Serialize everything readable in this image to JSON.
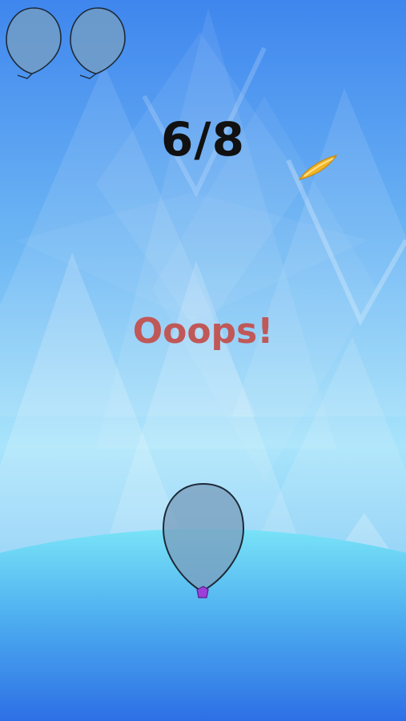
{
  "game": {
    "score_text": "6/8",
    "status_text": "Ooops!",
    "lives_remaining": 2
  },
  "colors": {
    "sky_top": "#3f86ee",
    "sky_mid": "#8fd8f8",
    "sky_bottom": "#5cb0f0",
    "ground_top": "#79e3f7",
    "ground_bottom": "#2d6fe6",
    "balloon_fill": "#7a9fbe",
    "balloon_knot": "#9b3fd8",
    "status_color": "#c05858",
    "score_color": "#111111",
    "dart_color": "#f1b52a"
  },
  "icons": {
    "life": "balloon-icon",
    "player": "balloon",
    "obstacle": "dart"
  }
}
